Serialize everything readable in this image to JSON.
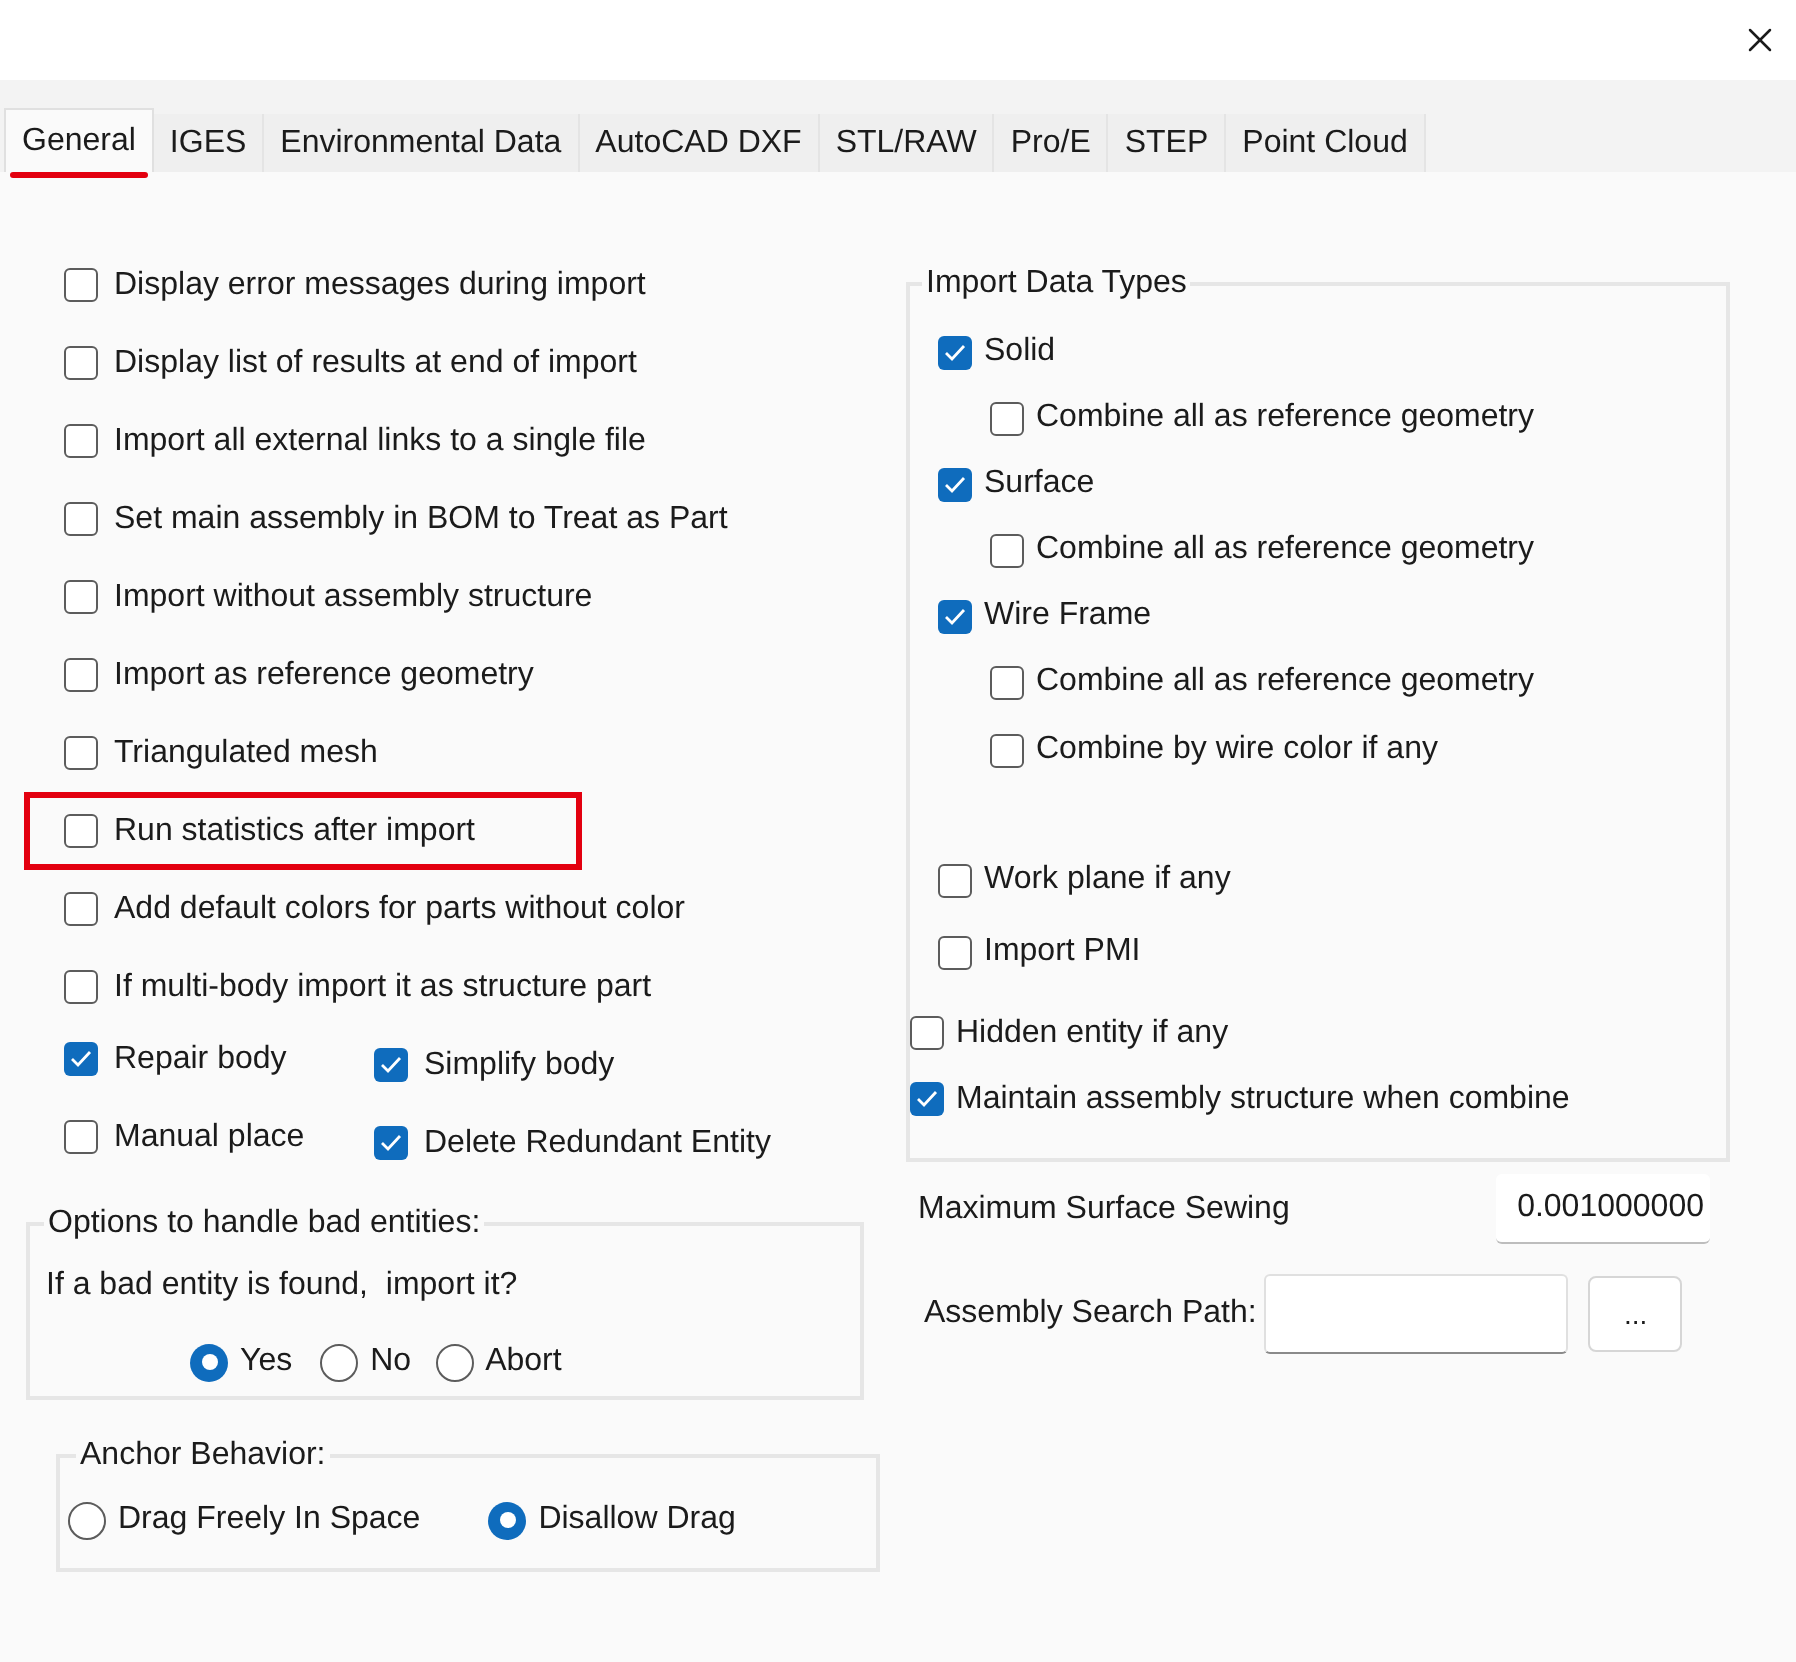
{
  "tabs": [
    {
      "label": "General",
      "selected": true,
      "marked": true
    },
    {
      "label": "IGES",
      "selected": false,
      "marked": false
    },
    {
      "label": "Environmental Data",
      "selected": false,
      "marked": false
    },
    {
      "label": "AutoCAD DXF",
      "selected": false,
      "marked": false
    },
    {
      "label": "STL/RAW",
      "selected": false,
      "marked": false
    },
    {
      "label": "Pro/E",
      "selected": false,
      "marked": false
    },
    {
      "label": "STEP",
      "selected": false,
      "marked": false
    },
    {
      "label": "Point Cloud",
      "selected": false,
      "marked": false
    }
  ],
  "general_options": [
    {
      "label": "Display error messages during import",
      "checked": false,
      "highlighted": false
    },
    {
      "label": "Display list of results at end of import",
      "checked": false,
      "highlighted": false
    },
    {
      "label": "Import all external links to a single file",
      "checked": false,
      "highlighted": false
    },
    {
      "label": "Set main assembly in BOM to Treat as Part",
      "checked": false,
      "highlighted": false
    },
    {
      "label": "Import without assembly structure",
      "checked": false,
      "highlighted": false
    },
    {
      "label": "Import as reference geometry",
      "checked": false,
      "highlighted": false
    },
    {
      "label": "Triangulated mesh",
      "checked": false,
      "highlighted": false
    },
    {
      "label": "Run statistics after import",
      "checked": false,
      "highlighted": true
    },
    {
      "label": "Add default colors for parts without color",
      "checked": false,
      "highlighted": false
    },
    {
      "label": "If multi-body import it as structure part",
      "checked": false,
      "highlighted": false
    }
  ],
  "body_options": [
    {
      "label": "Repair body",
      "checked": true
    },
    {
      "label": "Simplify body",
      "checked": true
    },
    {
      "label": "Manual place",
      "checked": false
    },
    {
      "label": "Delete Redundant Entity",
      "checked": true
    }
  ],
  "bad_entities": {
    "title": "Options to handle bad entities:",
    "question": "If a bad entity is found,  import it?",
    "choices": [
      {
        "label": "Yes",
        "selected": true
      },
      {
        "label": "No",
        "selected": false
      },
      {
        "label": "Abort",
        "selected": false
      }
    ]
  },
  "anchor_behavior": {
    "title": "Anchor Behavior:",
    "choices": [
      {
        "label": "Drag Freely In Space",
        "selected": false
      },
      {
        "label": "Disallow Drag",
        "selected": true
      }
    ]
  },
  "import_data_types": {
    "title": "Import Data Types",
    "types": [
      {
        "label": "Solid",
        "checked": true,
        "children": [
          {
            "label": "Combine all as reference geometry",
            "checked": false
          }
        ]
      },
      {
        "label": "Surface",
        "checked": true,
        "children": [
          {
            "label": "Combine all as reference geometry",
            "checked": false
          }
        ]
      },
      {
        "label": "Wire Frame",
        "checked": true,
        "children": [
          {
            "label": "Combine all as reference geometry",
            "checked": false
          },
          {
            "label": "Combine by wire color if any",
            "checked": false
          }
        ]
      }
    ],
    "options": [
      {
        "label": "Work plane if any",
        "checked": false
      },
      {
        "label": "Import PMI",
        "checked": false
      }
    ],
    "extra_options": [
      {
        "label": "Hidden entity if any",
        "checked": false
      },
      {
        "label": "Maintain assembly structure when combine",
        "checked": true
      }
    ]
  },
  "max_surface_sewing": {
    "label": "Maximum Surface Sewing",
    "value": "0.001000000"
  },
  "assembly_search_path": {
    "label": "Assembly Search Path:",
    "browse_button": "..."
  }
}
